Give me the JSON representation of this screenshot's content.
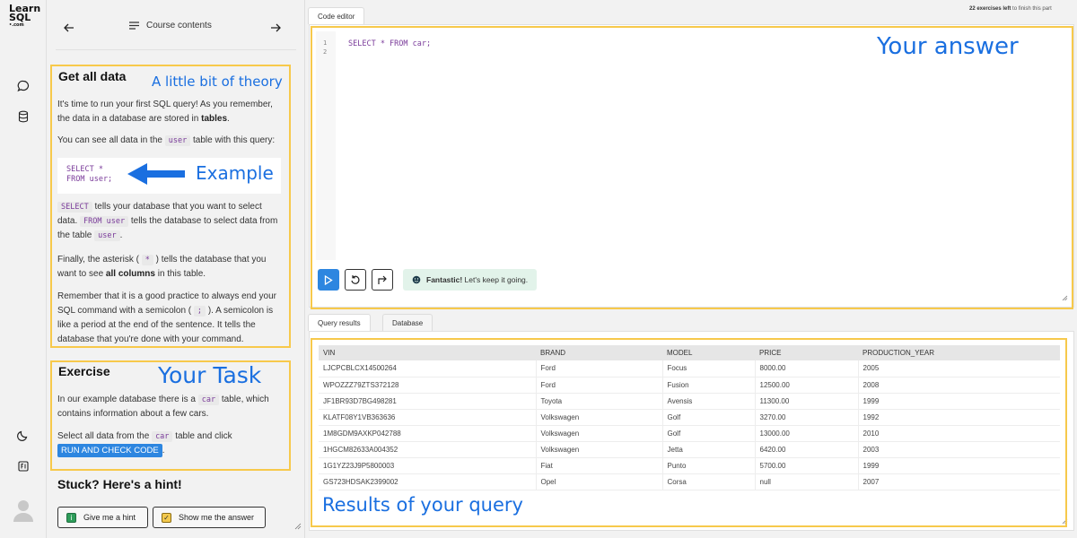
{
  "logo": {
    "line1": "Learn",
    "line2": "SQL",
    "line3": "•.com"
  },
  "nav": {
    "title": "Course contents"
  },
  "theory": {
    "title": "Get all data",
    "p1_a": "It's time to run your first SQL query! As you remember, the data in a database are stored in ",
    "p1_b": "tables",
    "p1_c": ".",
    "p2_a": "You can see all data in the ",
    "p2_code": "user",
    "p2_b": " table with this query:",
    "example_line1": "SELECT *",
    "example_line2": "FROM user;",
    "p3_code1": "SELECT",
    "p3_a": " tells your database that you want to select data. ",
    "p3_code2": "FROM user",
    "p3_b": " tells the database to select data from the table ",
    "p3_code3": "user",
    "p3_c": ".",
    "p4_a": "Finally, the asterisk ( ",
    "p4_code": "*",
    "p4_b": " ) tells the database that you want to see ",
    "p4_bold": "all columns",
    "p4_c": " in this table.",
    "p5_a": "Remember that it is a good practice to always end your SQL command with a semicolon ( ",
    "p5_code": ";",
    "p5_b": " ). A semicolon is like a period at the end of the sentence. It tells the database that you're done with your command."
  },
  "exercise": {
    "title": "Exercise",
    "p1_a": "In our example database there is a ",
    "p1_code": "car",
    "p1_b": " table, which contains information about a few cars.",
    "p2_a": "Select all data from the ",
    "p2_code": "car",
    "p2_b": " table and click ",
    "p2_chip": "RUN AND CHECK CODE",
    "p2_c": "."
  },
  "hint": {
    "title": "Stuck? Here's a hint!",
    "give_hint": "Give me a hint",
    "show_answer": "Show me the answer"
  },
  "annotations": {
    "theory": "A little bit of theory",
    "example": "Example",
    "task": "Your Task",
    "answer": "Your answer",
    "results": "Results of your query"
  },
  "editor": {
    "tab": "Code editor",
    "line_numbers": [
      "1",
      "2"
    ],
    "code": "SELECT * FROM car;",
    "toast_bold": "Fantastic!",
    "toast_text": " Let's keep it going."
  },
  "status": {
    "count": "22 exercises left",
    "rest": " to finish this part"
  },
  "results": {
    "tabs": [
      "Query results",
      "Database"
    ],
    "columns": [
      "VIN",
      "BRAND",
      "MODEL",
      "PRICE",
      "PRODUCTION_YEAR"
    ],
    "rows": [
      [
        "LJCPCBLCX14500264",
        "Ford",
        "Focus",
        "8000.00",
        "2005"
      ],
      [
        "WPOZZZ79ZTS372128",
        "Ford",
        "Fusion",
        "12500.00",
        "2008"
      ],
      [
        "JF1BR93D7BG498281",
        "Toyota",
        "Avensis",
        "11300.00",
        "1999"
      ],
      [
        "KLATF08Y1VB363636",
        "Volkswagen",
        "Golf",
        "3270.00",
        "1992"
      ],
      [
        "1M8GDM9AXKP042788",
        "Volkswagen",
        "Golf",
        "13000.00",
        "2010"
      ],
      [
        "1HGCM82633A004352",
        "Volkswagen",
        "Jetta",
        "6420.00",
        "2003"
      ],
      [
        "1G1YZ23J9P5800003",
        "Fiat",
        "Punto",
        "5700.00",
        "1999"
      ],
      [
        "GS723HDSAK2399002",
        "Opel",
        "Corsa",
        "null",
        "2007"
      ]
    ]
  },
  "colors": {
    "accent": "#2d86e0",
    "highlight_box": "#f7c94b",
    "annotation": "#1a6fe0",
    "toast_bg": "#e2f3ea"
  }
}
